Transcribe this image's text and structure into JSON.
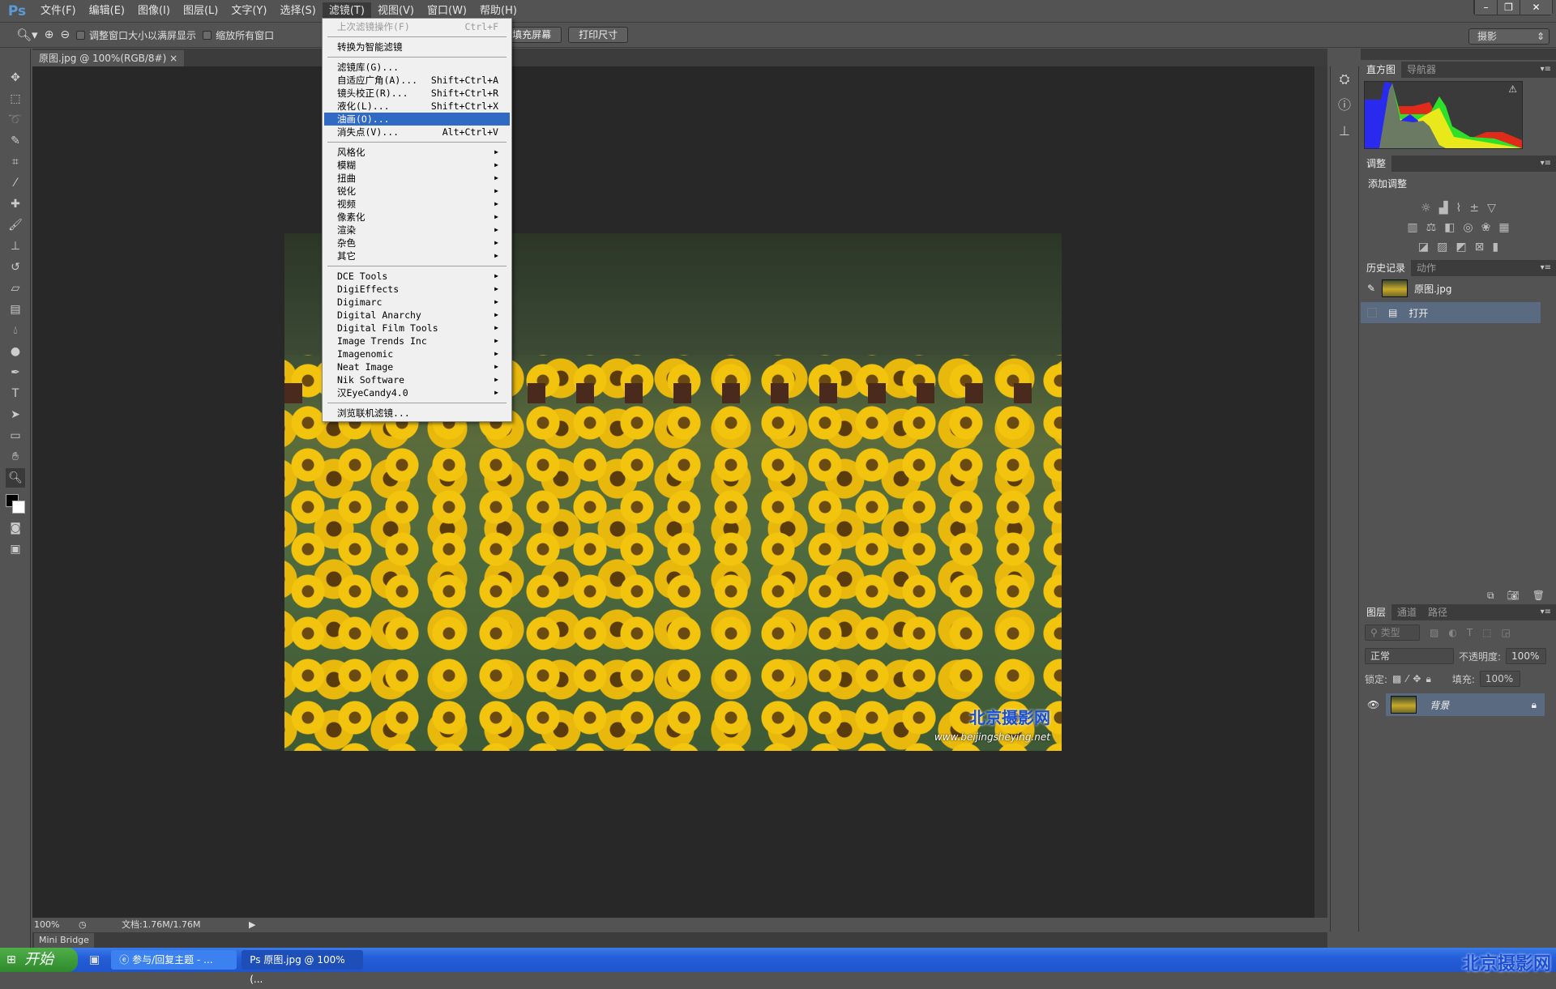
{
  "app": {
    "logo": "Ps"
  },
  "menubar": [
    "文件(F)",
    "编辑(E)",
    "图像(I)",
    "图层(L)",
    "文字(Y)",
    "选择(S)",
    "滤镜(T)",
    "视图(V)",
    "窗口(W)",
    "帮助(H)"
  ],
  "window_controls": {
    "minimize": "–",
    "restore": "❐",
    "close": "✕"
  },
  "options": {
    "resize_windows": "调整窗口大小以满屏显示",
    "zoom_all": "缩放所有窗口",
    "fill_screen": "填充屏幕",
    "print_size": "打印尺寸",
    "workspace": "摄影"
  },
  "document": {
    "tab": "原图.jpg @ 100%(RGB/8#)",
    "close": "×",
    "watermark_cn": "北京摄影网",
    "watermark_url": "www.beijingsheying.net"
  },
  "filter_menu": {
    "last_filter": {
      "label": "上次滤镜操作(F)",
      "shortcut": "Ctrl+F"
    },
    "smart": "转换为智能滤镜",
    "group1": [
      {
        "label": "滤镜库(G)...",
        "shortcut": ""
      },
      {
        "label": "自适应广角(A)...",
        "shortcut": "Shift+Ctrl+A"
      },
      {
        "label": "镜头校正(R)...",
        "shortcut": "Shift+Ctrl+R"
      },
      {
        "label": "液化(L)...",
        "shortcut": "Shift+Ctrl+X"
      },
      {
        "label": "油画(O)...",
        "shortcut": "",
        "highlighted": true
      },
      {
        "label": "消失点(V)...",
        "shortcut": "Alt+Ctrl+V"
      }
    ],
    "group2": [
      "风格化",
      "模糊",
      "扭曲",
      "锐化",
      "视频",
      "像素化",
      "渲染",
      "杂色",
      "其它"
    ],
    "group3": [
      "DCE Tools",
      "DigiEffects",
      "Digimarc",
      "Digital Anarchy",
      "Digital Film Tools",
      "Image Trends Inc",
      "Imagenomic",
      "Neat Image",
      "Nik Software",
      "汉EyeCandy4.0"
    ],
    "browse": "浏览联机滤镜..."
  },
  "panels": {
    "histogram": {
      "tabs": [
        "直方图",
        "导航器"
      ]
    },
    "adjustments": {
      "tab": "调整",
      "title": "添加调整"
    },
    "history": {
      "tabs": [
        "历史记录",
        "动作"
      ],
      "items": [
        "原图.jpg",
        "打开"
      ]
    },
    "layers": {
      "tabs": [
        "图层",
        "通道",
        "路径"
      ],
      "filter": "类型",
      "blend": "正常",
      "opacity_label": "不透明度:",
      "opacity": "100%",
      "lock_label": "锁定:",
      "fill_label": "填充:",
      "fill": "100%",
      "layer_name": "背景"
    }
  },
  "status": {
    "zoom": "100%",
    "doc": "文档:1.76M/1.76M",
    "minibridge": "Mini Bridge"
  },
  "taskbar": {
    "start": "开始",
    "tasks": [
      "参与/回复主题 - ...",
      "原图.jpg @ 100%(..."
    ],
    "tray": "北京摄影网"
  }
}
